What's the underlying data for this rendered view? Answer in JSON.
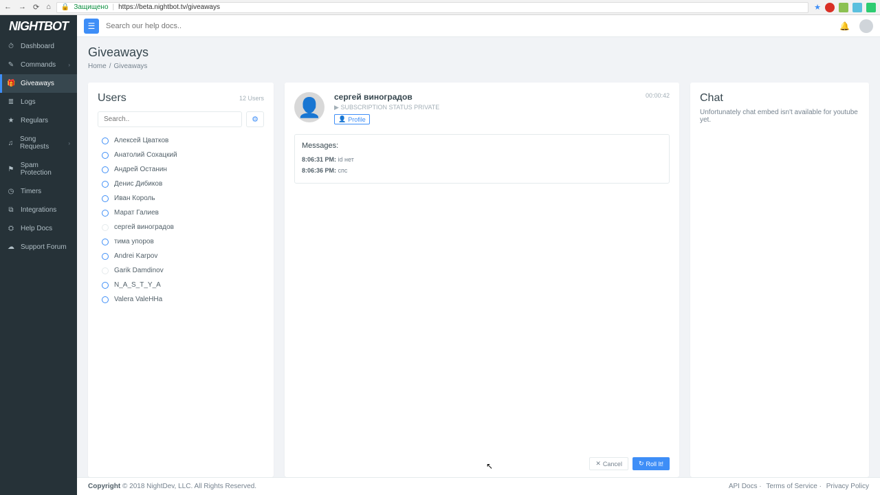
{
  "browser": {
    "secure_label": "Защищено",
    "url": "https://beta.nightbot.tv/giveaways"
  },
  "logo": "NIGHTBOT",
  "nav": [
    {
      "icon": "⏱",
      "label": "Dashboard",
      "active": false,
      "sub": false
    },
    {
      "icon": "✎",
      "label": "Commands",
      "active": false,
      "sub": true
    },
    {
      "icon": "🎁",
      "label": "Giveaways",
      "active": true,
      "sub": false
    },
    {
      "icon": "≣",
      "label": "Logs",
      "active": false,
      "sub": false
    },
    {
      "icon": "★",
      "label": "Regulars",
      "active": false,
      "sub": false
    },
    {
      "icon": "♫",
      "label": "Song Requests",
      "active": false,
      "sub": true
    },
    {
      "icon": "⚑",
      "label": "Spam Protection",
      "active": false,
      "sub": false
    },
    {
      "icon": "◷",
      "label": "Timers",
      "active": false,
      "sub": false
    },
    {
      "icon": "⧉",
      "label": "Integrations",
      "active": false,
      "sub": false
    },
    {
      "icon": "⛭",
      "label": "Help Docs",
      "active": false,
      "sub": false
    },
    {
      "icon": "☁",
      "label": "Support Forum",
      "active": false,
      "sub": false
    }
  ],
  "search_placeholder": "Search our help docs..",
  "page": {
    "title": "Giveaways",
    "breadcrumb_home": "Home",
    "breadcrumb_current": "Giveaways"
  },
  "users": {
    "title": "Users",
    "count": "12 Users",
    "search_placeholder": "Search..",
    "list": [
      {
        "name": "Алексей Цватков",
        "sel": true
      },
      {
        "name": "Анатолий Сохацкий",
        "sel": true
      },
      {
        "name": "Андрей Останин",
        "sel": true
      },
      {
        "name": "Денис Дибиков",
        "sel": true
      },
      {
        "name": "Иван Король",
        "sel": true
      },
      {
        "name": "Марат Галиев",
        "sel": true
      },
      {
        "name": "сергей виноградов",
        "sel": false
      },
      {
        "name": "тима упоров",
        "sel": true
      },
      {
        "name": "Andrei Karpov",
        "sel": true
      },
      {
        "name": "Garik Damdinov",
        "sel": false
      },
      {
        "name": "N_A_S_T_Y_A",
        "sel": true
      },
      {
        "name": "Valera ValeHHa",
        "sel": true
      }
    ]
  },
  "winner": {
    "name": "сергей виноградов",
    "sub_status": "SUBSCRIPTION STATUS PRIVATE",
    "profile_label": "Profile",
    "timer": "00:00:42",
    "messages_title": "Messages:",
    "messages": [
      {
        "time": "8:06:31 PM:",
        "text": "id нет"
      },
      {
        "time": "8:06:36 PM:",
        "text": "спс"
      }
    ],
    "cancel_label": "Cancel",
    "roll_label": "Roll It!"
  },
  "chat": {
    "title": "Chat",
    "message": "Unfortunately chat embed isn't available for youtube yet."
  },
  "footer": {
    "copyright_bold": "Copyright",
    "copyright_rest": " © 2018 NightDev, LLC. All Rights Reserved.",
    "links": [
      "API Docs",
      "Terms of Service",
      "Privacy Policy"
    ]
  }
}
